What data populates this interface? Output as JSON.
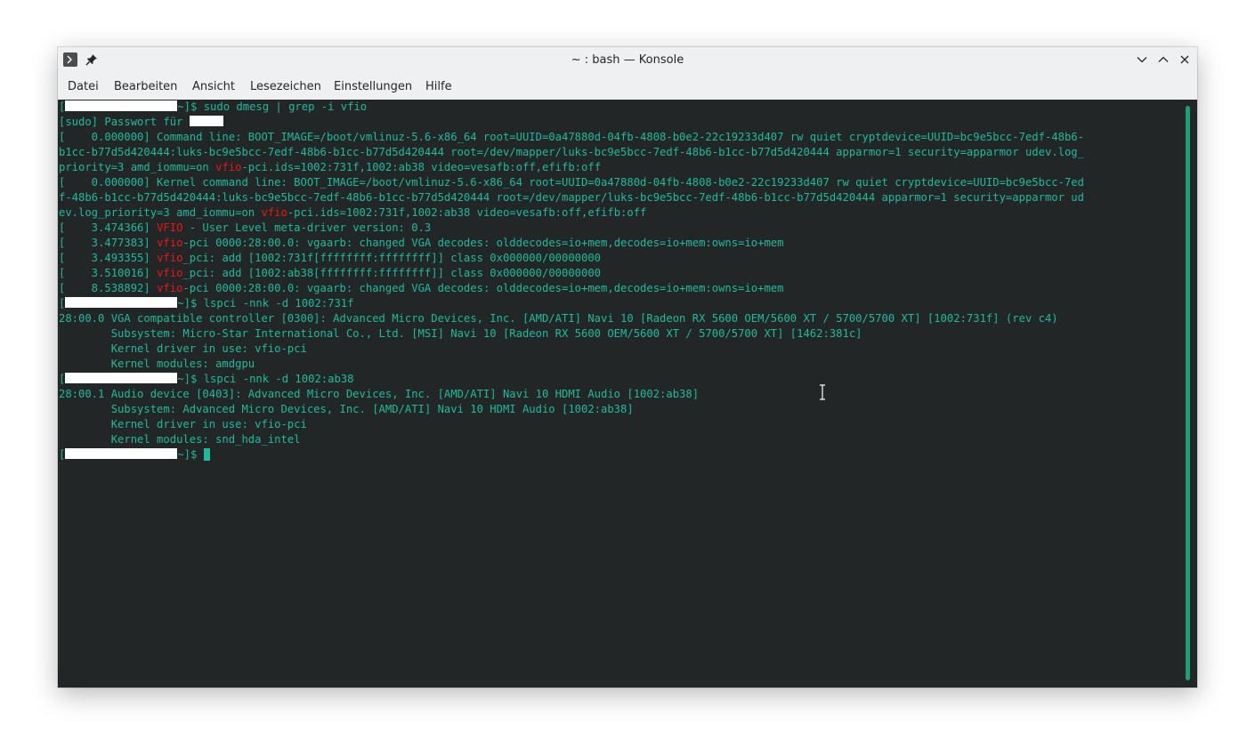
{
  "window": {
    "title": "~ : bash — Konsole",
    "icons": [
      "terminal-app-icon",
      "pin-icon",
      "minimize-icon",
      "maximize-icon",
      "close-icon"
    ]
  },
  "menu": {
    "items": [
      "Datei",
      "Bearbeiten",
      "Ansicht",
      "Lesezeichen",
      "Einstellungen",
      "Hilfe"
    ]
  },
  "terminal": {
    "colors": {
      "background": "#232627",
      "text": "#1abc9c",
      "highlight": "#ed1515"
    },
    "lines": [
      {
        "prompt": "~]$ ",
        "cmd": "sudo dmesg | grep -i vfio"
      },
      {
        "a": "[sudo] Passwort für "
      },
      {
        "a": "[    0.000000] Command line: BOOT_IMAGE=/boot/vmlinuz-5.6-x86_64 root=UUID=0a47880d-04fb-4808-b0e2-22c19233d407 rw quiet cryptdevice=UUID=bc9e5bcc-7edf-48b6-"
      },
      {
        "a": "b1cc-b77d5d420444:luks-bc9e5bcc-7edf-48b6-b1cc-b77d5d420444 root=/dev/mapper/luks-bc9e5bcc-7edf-48b6-b1cc-b77d5d420444 apparmor=1 security=apparmor udev.log_"
      },
      {
        "a": "priority=3 amd_iommu=on ",
        "r": "vfio",
        "b": "-pci.ids=1002:731f,1002:ab38 video=vesafb:off,efifb:off"
      },
      {
        "a": "[    0.000000] Kernel command line: BOOT_IMAGE=/boot/vmlinuz-5.6-x86_64 root=UUID=0a47880d-04fb-4808-b0e2-22c19233d407 rw quiet cryptdevice=UUID=bc9e5bcc-7ed"
      },
      {
        "a": "f-48b6-b1cc-b77d5d420444:luks-bc9e5bcc-7edf-48b6-b1cc-b77d5d420444 root=/dev/mapper/luks-bc9e5bcc-7edf-48b6-b1cc-b77d5d420444 apparmor=1 security=apparmor ud"
      },
      {
        "a": "ev.log_priority=3 amd_iommu=on ",
        "r": "vfio",
        "b": "-pci.ids=1002:731f,1002:ab38 video=vesafb:off,efifb:off"
      },
      {
        "a": "[    3.474366] ",
        "r": "VFIO",
        "b": " - User Level meta-driver version: 0.3"
      },
      {
        "a": "[    3.477383] ",
        "r": "vfio",
        "b": "-pci 0000:28:00.0: vgaarb: changed VGA decodes: olddecodes=io+mem,decodes=io+mem:owns=io+mem"
      },
      {
        "a": "[    3.493355] ",
        "r": "vfio",
        "b": "_pci: add [1002:731f[ffffffff:ffffffff]] class 0x000000/00000000"
      },
      {
        "a": "[    3.510016] ",
        "r": "vfio",
        "b": "_pci: add [1002:ab38[ffffffff:ffffffff]] class 0x000000/00000000"
      },
      {
        "a": "[    8.538892] ",
        "r": "vfio",
        "b": "-pci 0000:28:00.0: vgaarb: changed VGA decodes: olddecodes=io+mem,decodes=io+mem:owns=io+mem"
      },
      {
        "prompt": "~]$ ",
        "cmd": "lspci -nnk -d 1002:731f"
      },
      {
        "a": "28:00.0 VGA compatible controller [0300]: Advanced Micro Devices, Inc. [AMD/ATI] Navi 10 [Radeon RX 5600 OEM/5600 XT / 5700/5700 XT] [1002:731f] (rev c4)"
      },
      {
        "a": "        Subsystem: Micro-Star International Co., Ltd. [MSI] Navi 10 [Radeon RX 5600 OEM/5600 XT / 5700/5700 XT] [1462:381c]"
      },
      {
        "a": "        Kernel driver in use: vfio-pci"
      },
      {
        "a": "        Kernel modules: amdgpu"
      },
      {
        "prompt": "~]$ ",
        "cmd": "lspci -nnk -d 1002:ab38"
      },
      {
        "a": "28:00.1 Audio device [0403]: Advanced Micro Devices, Inc. [AMD/ATI] Navi 10 HDMI Audio [1002:ab38]"
      },
      {
        "a": "        Subsystem: Advanced Micro Devices, Inc. [AMD/ATI] Navi 10 HDMI Audio [1002:ab38]"
      },
      {
        "a": "        Kernel driver in use: vfio-pci"
      },
      {
        "a": "        Kernel modules: snd_hda_intel"
      },
      {
        "prompt": "~]$ ",
        "cmd": "",
        "cursor": true
      }
    ]
  }
}
